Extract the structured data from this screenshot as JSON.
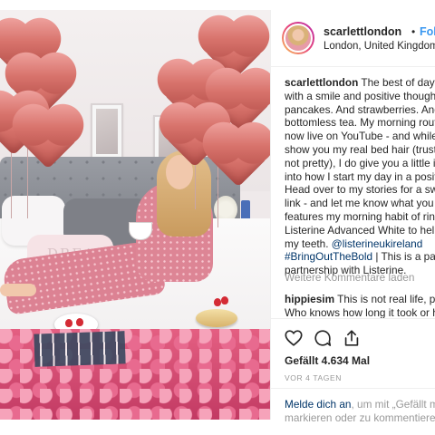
{
  "post": {
    "username": "scarlettlondon",
    "separator": "•",
    "follow_label": "Folgen",
    "location": "London, United Kingdom"
  },
  "caption": {
    "lines": [
      "The best of days s",
      "with a smile and positive thoughts",
      "pancakes. And strawberries. And",
      "bottomless tea. My morning routin",
      "now live on YouTube - and while I c",
      "show you my real bed hair (trust m",
      "not pretty), I do give you a little ins",
      "into how I start my day in a positive",
      "Head over to my stories for a swipe",
      "link - and let me know what you th",
      "features my morning habit of rinsin",
      "Listerine Advanced White to help v",
      "my teeth. ",
      "| This is a paid",
      "partnership with Listerine."
    ],
    "mention": "@listerineukireland",
    "hashtag": "#BringOutTheBold"
  },
  "more_comments": "Weitere Kommentare laden",
  "comment": {
    "username": "hippiesim",
    "lines": [
      " This is not real life, peop",
      "Who knows how long it took or how"
    ]
  },
  "actions": {
    "like_icon": "heart-icon",
    "comment_icon": "comment-icon",
    "share_icon": "share-icon"
  },
  "likes": "Gefällt 4.634 Mal",
  "timestamp": "VOR 4 TAGEN",
  "login": {
    "link_text": "Melde dich an",
    "line1_rest": ", um mit „Gefällt mir",
    "line2": "markieren oder zu kommentieren."
  },
  "photo": {
    "pillow_text": "DREA"
  }
}
